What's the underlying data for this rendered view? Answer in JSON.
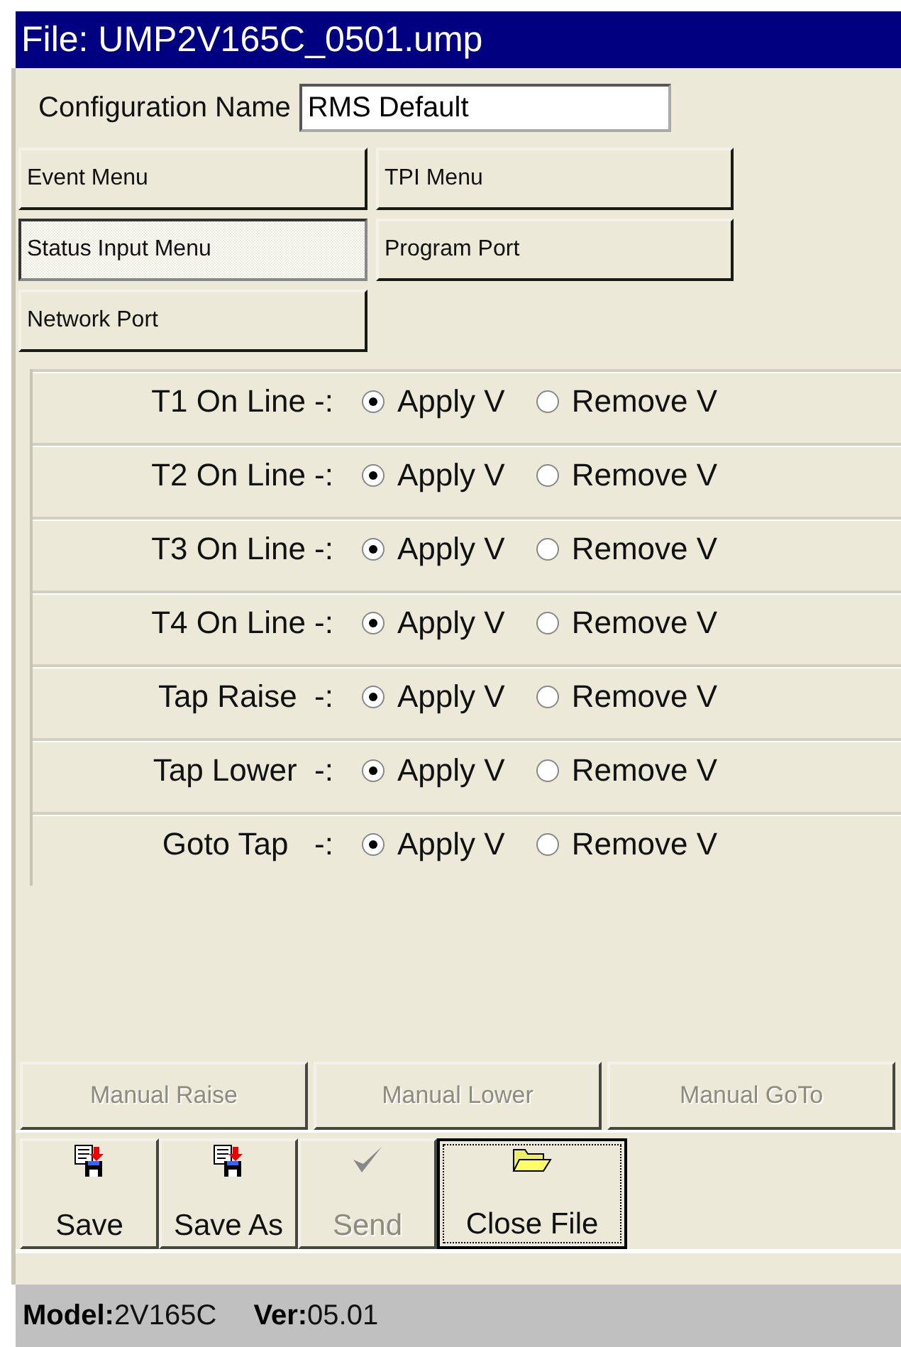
{
  "window": {
    "title": "File: UMP2V165C_0501.ump"
  },
  "config": {
    "label": "Configuration Name",
    "value": "RMS Default"
  },
  "menu_buttons": [
    {
      "label": "Event Menu",
      "selected": false
    },
    {
      "label": "TPI Menu",
      "selected": false
    },
    {
      "label": "Status Input Menu",
      "selected": true
    },
    {
      "label": "Program Port",
      "selected": false
    },
    {
      "label": "Network Port",
      "selected": false
    }
  ],
  "status_inputs": [
    {
      "label": "T1 On Line -:",
      "options": [
        {
          "label": "Apply V",
          "selected": true
        },
        {
          "label": "Remove V",
          "selected": false
        }
      ]
    },
    {
      "label": "T2 On Line -:",
      "options": [
        {
          "label": "Apply V",
          "selected": true
        },
        {
          "label": "Remove V",
          "selected": false
        }
      ]
    },
    {
      "label": "T3 On Line -:",
      "options": [
        {
          "label": "Apply V",
          "selected": true
        },
        {
          "label": "Remove V",
          "selected": false
        }
      ]
    },
    {
      "label": "T4 On Line -:",
      "options": [
        {
          "label": "Apply V",
          "selected": true
        },
        {
          "label": "Remove V",
          "selected": false
        }
      ]
    },
    {
      "label": "Tap Raise  -:",
      "options": [
        {
          "label": "Apply V",
          "selected": true
        },
        {
          "label": "Remove V",
          "selected": false
        }
      ]
    },
    {
      "label": "Tap Lower  -:",
      "options": [
        {
          "label": "Apply V",
          "selected": true
        },
        {
          "label": "Remove V",
          "selected": false
        }
      ]
    },
    {
      "label": "Goto Tap   -:",
      "options": [
        {
          "label": "Apply V",
          "selected": true
        },
        {
          "label": "Remove V",
          "selected": false
        }
      ]
    }
  ],
  "manual_buttons": [
    {
      "label": "Manual Raise",
      "disabled": true
    },
    {
      "label": "Manual Lower",
      "disabled": true
    },
    {
      "label": "Manual GoTo",
      "disabled": true
    }
  ],
  "toolbar": [
    {
      "label": "Save",
      "kind": "save",
      "disabled": false,
      "focused": false
    },
    {
      "label": "Save As",
      "kind": "save",
      "disabled": false,
      "focused": false
    },
    {
      "label": "Send",
      "kind": "check",
      "disabled": true,
      "focused": false
    },
    {
      "label": "Close File",
      "kind": "folder",
      "disabled": false,
      "focused": true
    }
  ],
  "status_bar": [
    {
      "label": "Model:",
      "value": "2V165C"
    },
    {
      "label": "Ver:",
      "value": "05.01"
    }
  ]
}
